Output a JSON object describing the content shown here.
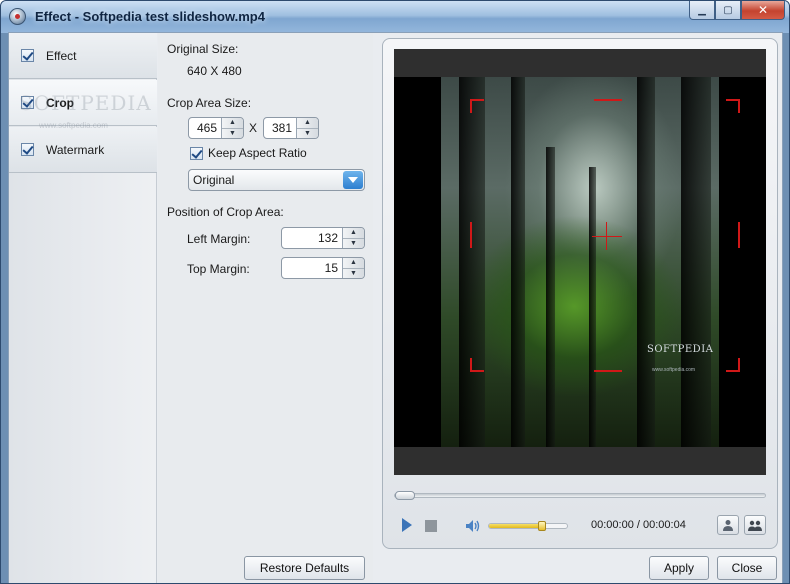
{
  "window": {
    "title": "Effect - Softpedia test slideshow.mp4",
    "min_glyph": "▁",
    "max_glyph": "▢",
    "close_glyph": "✕"
  },
  "nav": {
    "items": [
      {
        "label": "Effect",
        "checked": true,
        "selected": false
      },
      {
        "label": "Crop",
        "checked": true,
        "selected": true
      },
      {
        "label": "Watermark",
        "checked": true,
        "selected": false
      }
    ]
  },
  "background_watermark": {
    "logo": "SOFTPEDIA",
    "url": "www.softpedia.com"
  },
  "settings": {
    "original_size_label": "Original Size:",
    "original_size_value": "640 X 480",
    "crop_area_size_label": "Crop Area Size:",
    "crop_width": "465",
    "crop_x_sep": "X",
    "crop_height": "381",
    "keep_aspect_label": "Keep Aspect Ratio",
    "keep_aspect_checked": true,
    "aspect_selected": "Original",
    "position_label": "Position of Crop Area:",
    "left_margin_label": "Left Margin:",
    "left_margin_value": "132",
    "top_margin_label": "Top Margin:",
    "top_margin_value": "15",
    "restore_defaults": "Restore Defaults"
  },
  "preview": {
    "video_logo": "SOFTPEDIA",
    "video_url": "www.softpedia.com",
    "time_display": "00:00:00 / 00:00:04",
    "volume_fraction": 0.68,
    "seek_fraction": 0.0,
    "accent_color": "#d01818"
  },
  "footer": {
    "apply": "Apply",
    "close": "Close"
  }
}
